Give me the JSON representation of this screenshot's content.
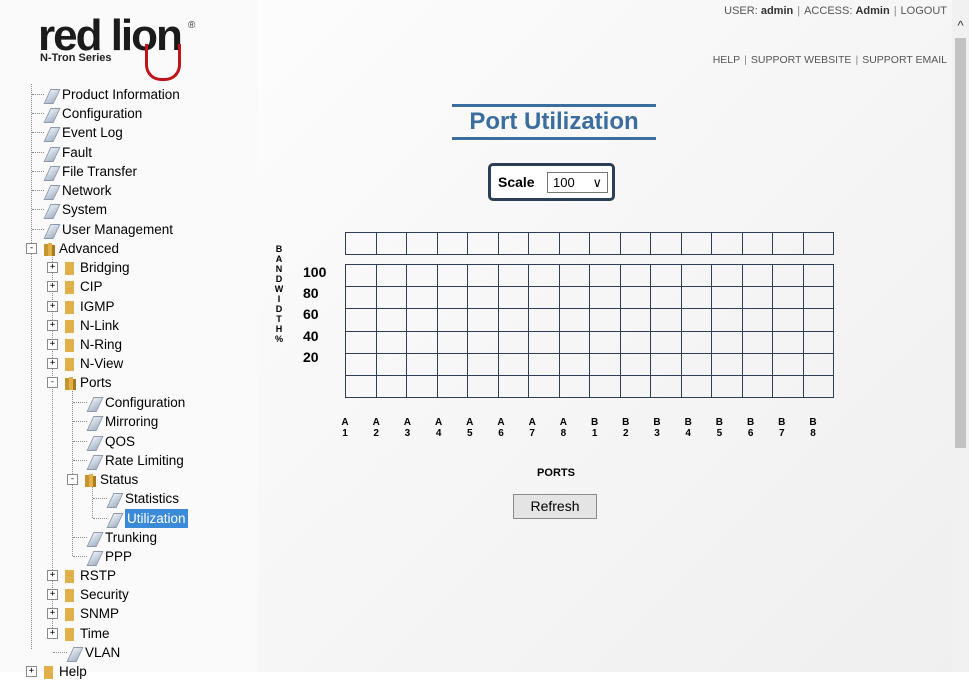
{
  "header": {
    "logo_word": "red lion",
    "logo_reg": "®",
    "logo_series": "N-Tron Series",
    "user_label": "USER:",
    "user_value": "admin",
    "access_label": "ACCESS:",
    "access_value": "Admin",
    "logout": "LOGOUT",
    "help": "HELP",
    "support_website": "SUPPORT WEBSITE",
    "support_email": "SUPPORT EMAIL"
  },
  "tree": {
    "product_information": "Product Information",
    "configuration": "Configuration",
    "event_log": "Event Log",
    "fault": "Fault",
    "file_transfer": "File Transfer",
    "network": "Network",
    "system": "System",
    "user_management": "User Management",
    "advanced": "Advanced",
    "bridging": "Bridging",
    "cip": "CIP",
    "igmp": "IGMP",
    "nlink": "N-Link",
    "nring": "N-Ring",
    "nview": "N-View",
    "ports": "Ports",
    "ports_configuration": "Configuration",
    "mirroring": "Mirroring",
    "qos": "QOS",
    "rate_limiting": "Rate Limiting",
    "status": "Status",
    "statistics": "Statistics",
    "utilization": "Utilization",
    "trunking": "Trunking",
    "ppp": "PPP",
    "rstp": "RSTP",
    "security": "Security",
    "snmp": "SNMP",
    "time": "Time",
    "vlan": "VLAN",
    "help": "Help"
  },
  "main": {
    "title": "Port Utilization",
    "scale_label": "Scale",
    "scale_value": "100",
    "refresh": "Refresh"
  },
  "chart_data": {
    "type": "bar",
    "ylabel": "BANDWIDTH %",
    "xlabel": "PORTS",
    "yticks": [
      "100",
      "80",
      "60",
      "40",
      "20"
    ],
    "ylim": [
      0,
      100
    ],
    "categories": [
      "A 1",
      "A 2",
      "A 3",
      "A 4",
      "A 5",
      "A 6",
      "A 7",
      "A 8",
      "B 1",
      "B 2",
      "B 3",
      "B 4",
      "B 5",
      "B 6",
      "B 7",
      "B 8"
    ],
    "port_groups": [
      "A",
      "A",
      "A",
      "A",
      "A",
      "A",
      "A",
      "A",
      "B",
      "B",
      "B",
      "B",
      "B",
      "B",
      "B",
      "B"
    ],
    "port_numbers": [
      "1",
      "2",
      "3",
      "4",
      "5",
      "6",
      "7",
      "8",
      "1",
      "2",
      "3",
      "4",
      "5",
      "6",
      "7",
      "8"
    ],
    "values": [
      0,
      0,
      0,
      0,
      0,
      0,
      0,
      0,
      0,
      0,
      0,
      0,
      0,
      0,
      0,
      0
    ],
    "grid": true
  },
  "colors": {
    "title": "#3b6e9e",
    "grid": "#2d3f57",
    "selected": "#3a8ad8",
    "logo_accent": "#c0141c"
  }
}
